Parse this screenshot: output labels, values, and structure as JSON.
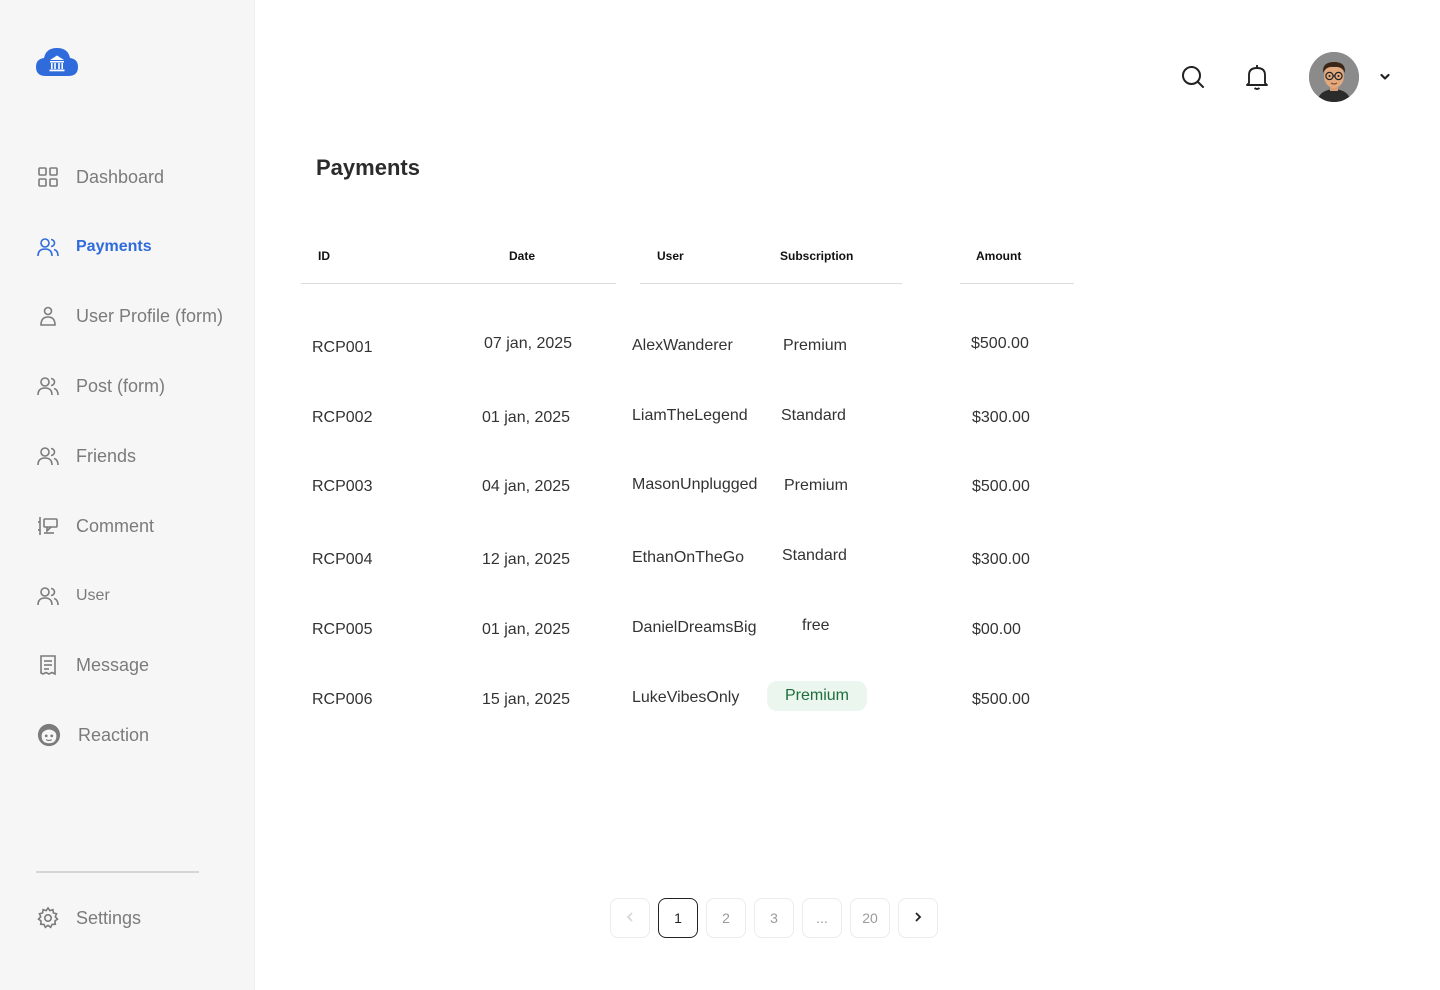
{
  "sidebar": {
    "items": [
      {
        "label": "Dashboard",
        "icon": "grid-icon"
      },
      {
        "label": "Payments",
        "icon": "users-icon"
      },
      {
        "label": "User Profile (form)",
        "icon": "user-icon"
      },
      {
        "label": "Post (form)",
        "icon": "users-icon"
      },
      {
        "label": "Friends",
        "icon": "users-icon"
      },
      {
        "label": "Comment",
        "icon": "comment-icon"
      },
      {
        "label": "User",
        "icon": "users-icon"
      },
      {
        "label": "Message",
        "icon": "receipt-icon"
      },
      {
        "label": "Reaction",
        "icon": "face-icon"
      }
    ],
    "settings_label": "Settings",
    "active_color": "#2f6bdb"
  },
  "page": {
    "title": "Payments"
  },
  "table": {
    "headers": [
      "ID",
      "Date",
      "User",
      "Subscription",
      "Amount"
    ],
    "rows": [
      {
        "id": "RCP001",
        "date": "07 jan, 2025",
        "user": "AlexWanderer",
        "subscription": "Premium",
        "amount": "$500.00"
      },
      {
        "id": "RCP002",
        "date": "01 jan, 2025",
        "user": "LiamTheLegend",
        "subscription": "Standard",
        "amount": "$300.00"
      },
      {
        "id": "RCP003",
        "date": "04 jan, 2025",
        "user": "MasonUnplugged",
        "subscription": "Premium",
        "amount": "$500.00"
      },
      {
        "id": "RCP004",
        "date": "12 jan, 2025",
        "user": "EthanOnTheGo",
        "subscription": "Standard",
        "amount": "$300.00"
      },
      {
        "id": "RCP005",
        "date": "01 jan, 2025",
        "user": "DanielDreamsBig",
        "subscription": "free",
        "amount": "$00.00"
      },
      {
        "id": "RCP006",
        "date": "15 jan, 2025",
        "user": "LukeVibesOnly",
        "subscription": "Premium",
        "amount": "$500.00"
      }
    ]
  },
  "pagination": {
    "pages": [
      "1",
      "2",
      "3",
      "...",
      "20"
    ],
    "current": "1"
  }
}
